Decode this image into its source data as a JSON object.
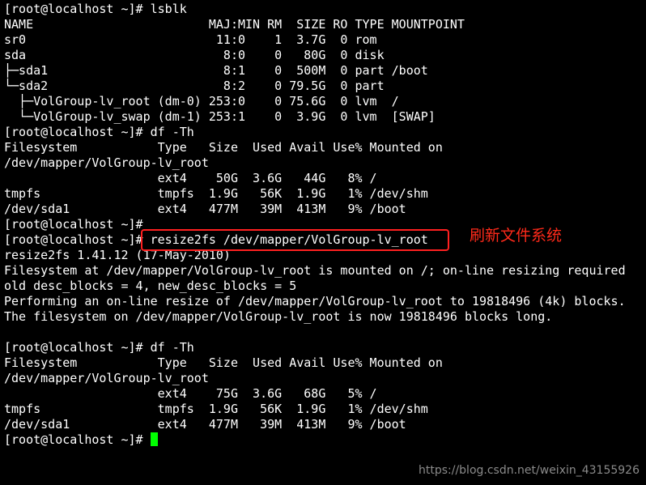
{
  "terminal": {
    "lines": [
      "[root@localhost ~]# lsblk",
      "NAME                        MAJ:MIN RM  SIZE RO TYPE MOUNTPOINT",
      "sr0                          11:0    1  3.7G  0 rom",
      "sda                           8:0    0   80G  0 disk",
      "├─sda1                        8:1    0  500M  0 part /boot",
      "└─sda2                        8:2    0 79.5G  0 part",
      "  ├─VolGroup-lv_root (dm-0) 253:0    0 75.6G  0 lvm  /",
      "  └─VolGroup-lv_swap (dm-1) 253:1    0  3.9G  0 lvm  [SWAP]",
      "[root@localhost ~]# df -Th",
      "Filesystem           Type   Size  Used Avail Use% Mounted on",
      "/dev/mapper/VolGroup-lv_root",
      "                     ext4    50G  3.6G   44G   8% /",
      "tmpfs                tmpfs  1.9G   56K  1.9G   1% /dev/shm",
      "/dev/sda1            ext4   477M   39M  413M   9% /boot",
      "[root@localhost ~]#",
      "[root@localhost ~]# resize2fs /dev/mapper/VolGroup-lv_root",
      "resize2fs 1.41.12 (17-May-2010)",
      "Filesystem at /dev/mapper/VolGroup-lv_root is mounted on /; on-line resizing required",
      "old desc_blocks = 4, new_desc_blocks = 5",
      "Performing an on-line resize of /dev/mapper/VolGroup-lv_root to 19818496 (4k) blocks.",
      "The filesystem on /dev/mapper/VolGroup-lv_root is now 19818496 blocks long.",
      "",
      "[root@localhost ~]# df -Th",
      "Filesystem           Type   Size  Used Avail Use% Mounted on",
      "/dev/mapper/VolGroup-lv_root",
      "                     ext4    75G  3.6G   68G   5% /",
      "tmpfs                tmpfs  1.9G   56K  1.9G   1% /dev/shm",
      "/dev/sda1            ext4   477M   39M  413M   9% /boot"
    ],
    "prompt": "[root@localhost ~]# ",
    "cursor_color": "#00ff00",
    "text_color": "#ffffff",
    "background_color": "#000000"
  },
  "annotation": {
    "text": "刷新文件系统",
    "color": "#ff2a1a",
    "box_color": "#ff2020"
  },
  "watermark": {
    "text": "https://blog.csdn.net/weixin_43155926"
  }
}
